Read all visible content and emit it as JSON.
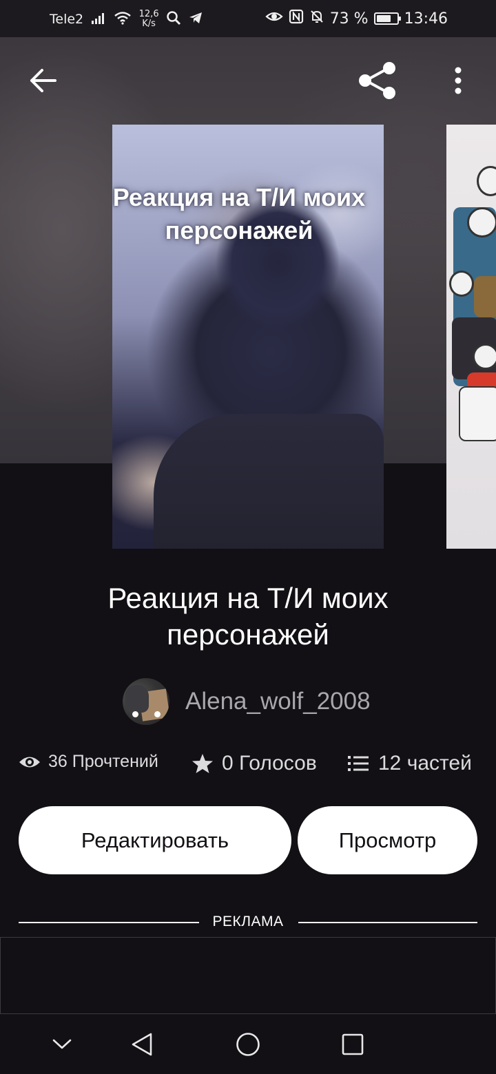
{
  "status_bar": {
    "carrier": "Tele2",
    "net_speed_value": "12,6",
    "net_speed_unit": "K/s",
    "battery_percent": "73 %",
    "battery_level": 0.73,
    "time": "13:46"
  },
  "story": {
    "cover_title": "Реакция на Т/И моих персонажей",
    "title": "Реакция на Т/И моих персонажей",
    "author": "Alena_wolf_2008"
  },
  "stats": {
    "reads": "36 Прочтений",
    "votes": "0 Голосов",
    "parts": "12 частей"
  },
  "actions": {
    "edit_label": "Редактировать",
    "view_label": "Просмотр"
  },
  "ad": {
    "label": "РЕКЛАМА"
  },
  "icons": {
    "back": "arrow-left-icon",
    "share": "share-icon",
    "more": "more-vertical-icon",
    "eye": "eye-icon",
    "star": "star-icon",
    "list": "list-icon",
    "nav_down": "chevron-down-icon",
    "nav_back": "triangle-back-icon",
    "nav_home": "circle-home-icon",
    "nav_recent": "square-recent-icon"
  },
  "colors": {
    "background": "#121014",
    "button_bg": "#ffffff",
    "button_text": "#121014",
    "author_text": "#a9a7ab",
    "stat_text": "#dcdbdd"
  }
}
